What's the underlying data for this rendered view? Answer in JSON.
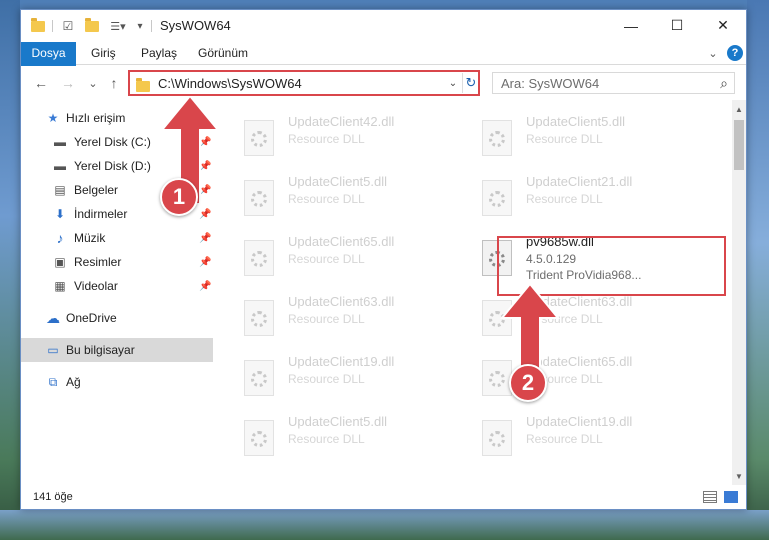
{
  "window": {
    "title": "SysWOW64"
  },
  "ribbon": {
    "tabs": [
      {
        "label": "Dosya"
      },
      {
        "label": "Giriş"
      },
      {
        "label": "Paylaş"
      },
      {
        "label": "Görünüm"
      }
    ],
    "help": "?"
  },
  "titlebar": {
    "minimize": "—",
    "maximize": "☐",
    "close": "✕"
  },
  "nav": {
    "back": "←",
    "forward": "→",
    "recent": "⌄",
    "up": "↑"
  },
  "address": {
    "path": "C:\\Windows\\SysWOW64",
    "dropdown": "⌄",
    "refresh": "↻"
  },
  "search": {
    "placeholder": "Ara: SysWOW64",
    "icon": "⌕"
  },
  "sidebar": {
    "items": [
      {
        "label": "Hızlı erişim",
        "icon": "star-icon",
        "glyph": "★"
      },
      {
        "label": "Yerel Disk (C:)",
        "icon": "drive-icon",
        "glyph": "▬",
        "pinned": true
      },
      {
        "label": "Yerel Disk (D:)",
        "icon": "drive-icon",
        "glyph": "▬",
        "pinned": true
      },
      {
        "label": "Belgeler",
        "icon": "document-icon",
        "glyph": "▤",
        "pinned": true
      },
      {
        "label": "İndirmeler",
        "icon": "download-icon",
        "glyph": "⬇",
        "pinned": true
      },
      {
        "label": "Müzik",
        "icon": "music-icon",
        "glyph": "♪",
        "pinned": true
      },
      {
        "label": "Resimler",
        "icon": "pictures-icon",
        "glyph": "▣",
        "pinned": true
      },
      {
        "label": "Videolar",
        "icon": "video-icon",
        "glyph": "▦",
        "pinned": true
      },
      {
        "label": "OneDrive",
        "icon": "cloud-icon",
        "glyph": "☁"
      },
      {
        "label": "Bu bilgisayar",
        "icon": "computer-icon",
        "glyph": "▭",
        "selected": true
      },
      {
        "label": "Ağ",
        "icon": "network-icon",
        "glyph": "⧉"
      }
    ],
    "pin_glyph": "📌"
  },
  "files": [
    {
      "name": "UpdateClient42.dll",
      "type": "Resource DLL"
    },
    {
      "name": "UpdateClient5.dll",
      "type": "Resource DLL"
    },
    {
      "name": "UpdateClient5.dll",
      "type": "Resource DLL"
    },
    {
      "name": "UpdateClient21.dll",
      "type": "Resource DLL"
    },
    {
      "name": "UpdateClient65.dll",
      "type": "Resource DLL"
    },
    {
      "name": "pv9685w.dll",
      "type": "4.5.0.129",
      "desc": "Trident ProVidia968...",
      "highlighted": true
    },
    {
      "name": "UpdateClient63.dll",
      "type": "Resource DLL"
    },
    {
      "name": "UpdateClient63.dll",
      "type": "Resource DLL"
    },
    {
      "name": "UpdateClient19.dll",
      "type": "Resource DLL"
    },
    {
      "name": "UpdateClient65.dll",
      "type": "Resource DLL"
    },
    {
      "name": "UpdateClient5.dll",
      "type": "Resource DLL"
    },
    {
      "name": "UpdateClient19.dll",
      "type": "Resource DLL"
    }
  ],
  "status": {
    "count": "141 öğe"
  },
  "annotations": {
    "step1": "1",
    "step2": "2",
    "color": "#d9464b"
  }
}
